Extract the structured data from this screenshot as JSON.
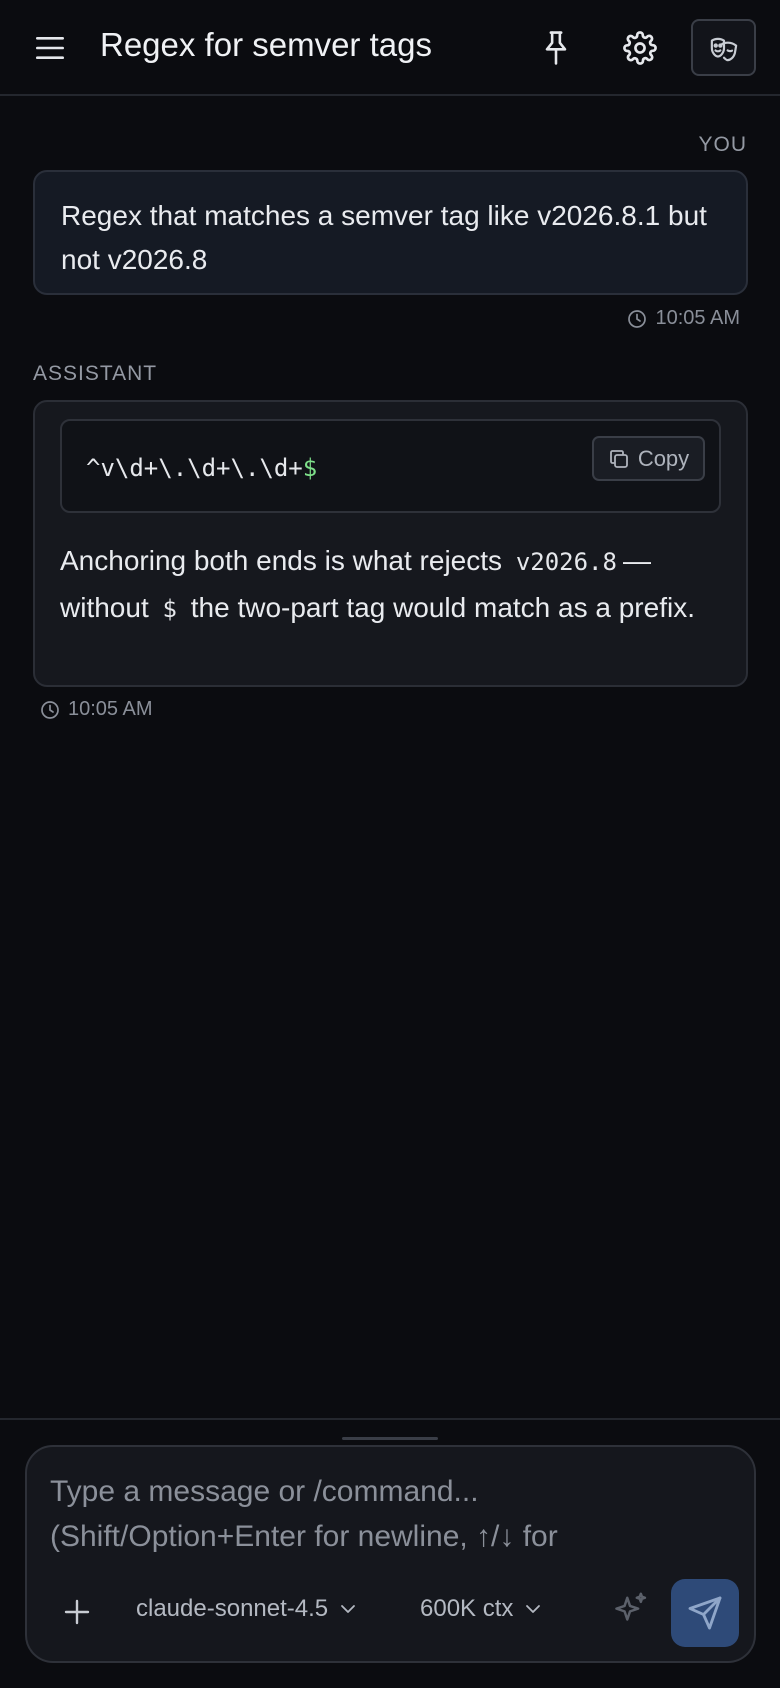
{
  "header": {
    "title": "Regex for semver tags",
    "icons": [
      "menu-icon",
      "pin-icon",
      "gear-icon",
      "theater-masks-icon"
    ]
  },
  "messages": [
    {
      "role_label": "YOU",
      "text": "Regex that matches a semver tag like v2026.8.1 but not v2026.8",
      "time": "10:05 AM"
    },
    {
      "role_label": "ASSISTANT",
      "code": "^v\\d+\\.\\d+\\.\\d+",
      "code_tail": "$",
      "copy_label": "Copy",
      "answer_part1": "Anchoring both ends is what rejects",
      "answer_code1": "v2026.8",
      "answer_part2": "— without",
      "answer_code2": "$",
      "answer_part3": "the two-part tag would match as a prefix.",
      "time": "10:05 AM"
    }
  ],
  "composer": {
    "placeholder": "Type a message or /command... (Shift/Option+Enter for newline, ↑/↓ for",
    "model": "claude-sonnet-4.5",
    "context": "600K ctx"
  },
  "colors": {
    "background": "#0b0c10",
    "accent_send": "#2e4a78",
    "code_dollar": "#7ee08a"
  }
}
